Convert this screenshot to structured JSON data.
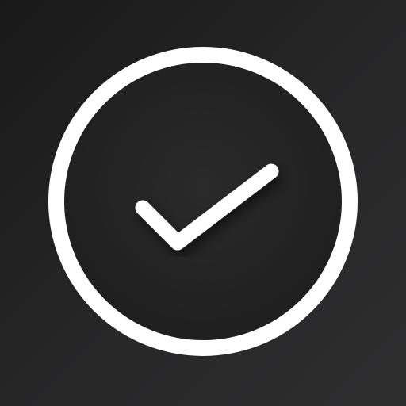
{
  "icon": {
    "name": "checkmark-circle-icon",
    "colors": {
      "background_start": "#19191a",
      "background_end": "#2f2e2f",
      "ring": "#ffffff",
      "checkmark": "#ffffff",
      "inner_fill": "#222223"
    }
  }
}
